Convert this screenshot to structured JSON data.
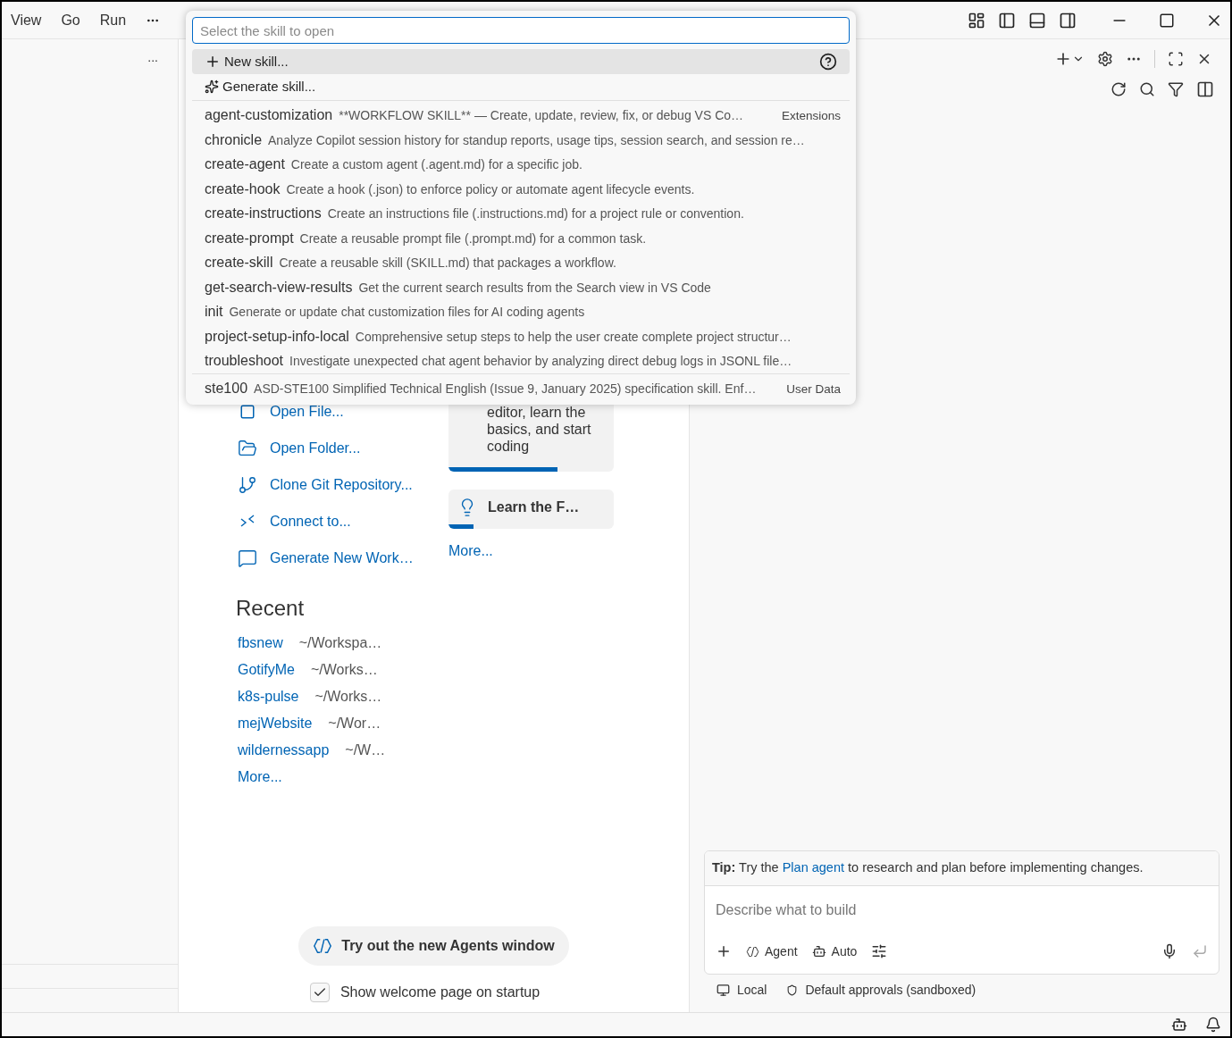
{
  "menu": [
    "View",
    "Go",
    "Run"
  ],
  "sidebar": {
    "overflow": "..."
  },
  "quick_pick": {
    "placeholder": "Select the skill to open",
    "actions": [
      {
        "kind": "new",
        "label": "New skill...",
        "selected": true
      },
      {
        "kind": "generate",
        "label": "Generate skill...",
        "selected": false
      }
    ],
    "skill_groups": [
      [
        {
          "name": "agent-customization",
          "description": "**WORKFLOW SKILL** — Create, update, review, fix, or debug VS Co…",
          "source": "Extensions"
        },
        {
          "name": "chronicle",
          "description": "Analyze Copilot session history for standup reports, usage tips, session search, and session re…"
        },
        {
          "name": "create-agent",
          "description": "Create a custom agent (.agent.md) for a specific job."
        },
        {
          "name": "create-hook",
          "description": "Create a hook (.json) to enforce policy or automate agent lifecycle events."
        },
        {
          "name": "create-instructions",
          "description": "Create an instructions file (.instructions.md) for a project rule or convention."
        },
        {
          "name": "create-prompt",
          "description": "Create a reusable prompt file (.prompt.md) for a common task."
        },
        {
          "name": "create-skill",
          "description": "Create a reusable skill (SKILL.md) that packages a workflow."
        },
        {
          "name": "get-search-view-results",
          "description": "Get the current search results from the Search view in VS Code"
        },
        {
          "name": "init",
          "description": "Generate or update chat customization files for AI coding agents"
        },
        {
          "name": "project-setup-info-local",
          "description": "Comprehensive setup steps to help the user create complete project structur…"
        },
        {
          "name": "troubleshoot",
          "description": "Investigate unexpected chat agent behavior by analyzing direct debug logs in JSONL file…"
        }
      ],
      [
        {
          "name": "ste100",
          "description": "ASD-STE100 Simplified Technical English (Issue 9, January 2025) specification skill. Enf…",
          "source": "User Data"
        }
      ]
    ]
  },
  "start": [
    {
      "kind": "file",
      "label": "Open File..."
    },
    {
      "kind": "folder",
      "label": "Open Folder..."
    },
    {
      "kind": "git",
      "label": "Clone Git Repository..."
    },
    {
      "kind": "remote",
      "label": "Connect to..."
    },
    {
      "kind": "generate",
      "label": "Generate New Work…"
    }
  ],
  "recent": {
    "title": "Recent",
    "items": [
      {
        "name": "fbsnew",
        "path": "~/Workspa…"
      },
      {
        "name": "GotifyMe",
        "path": "~/Works…"
      },
      {
        "name": "k8s-pulse",
        "path": "~/Works…"
      },
      {
        "name": "mejWebsite",
        "path": "~/Wor…"
      },
      {
        "name": "wildernessapp",
        "path": "~/W…"
      }
    ],
    "more": "More..."
  },
  "walkthroughs": {
    "items": [
      {
        "kind": "text",
        "text": "editor, learn the basics, and start coding",
        "level": 0.66
      },
      {
        "kind": "title",
        "text": "Learn the F…",
        "level": 0.15
      }
    ],
    "more": "More..."
  },
  "agents_button": "Try out the new Agents window",
  "startup_checkbox": {
    "label": "Show welcome page on startup",
    "checked": true
  },
  "chat": {
    "tip": {
      "prefix": "**Tip:** Try the",
      "link": "Plan agent",
      "suffix": "to research and plan before implementing changes."
    },
    "placeholder": "Describe what to build",
    "mode": "Agent",
    "model": "Auto",
    "footer": {
      "location": "Local",
      "approvals": "Default approvals (sandboxed)"
    }
  }
}
